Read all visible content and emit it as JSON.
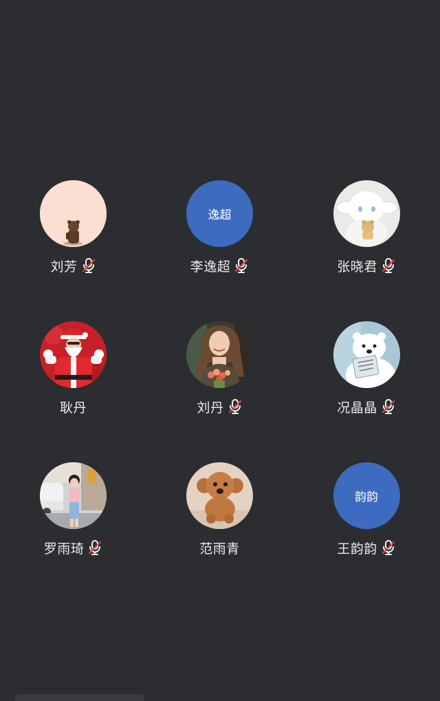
{
  "participants": [
    {
      "name": "刘芳",
      "avatar": "brown-bear-figure-on-peach",
      "muted": true
    },
    {
      "name": "李逸超",
      "avatar_text": "逸超",
      "muted": true
    },
    {
      "name": "张晓君",
      "avatar": "white-bunny-plush",
      "muted": true
    },
    {
      "name": "耿丹",
      "avatar": "santa-claus-on-red",
      "muted": false
    },
    {
      "name": "刘丹",
      "avatar": "woman-photo",
      "muted": true
    },
    {
      "name": "况晶晶",
      "avatar": "polar-bear-reading-book",
      "muted": true
    },
    {
      "name": "罗雨琦",
      "avatar": "girl-street-photo",
      "muted": true
    },
    {
      "name": "范雨青",
      "avatar": "brown-poodle-puppy",
      "muted": false
    },
    {
      "name": "王韵韵",
      "avatar_text": "韵韵",
      "muted": true
    }
  ],
  "colors": {
    "background": "#2b2d30",
    "text_avatar": "#3d6bc0",
    "muted_slash": "#e0453a"
  },
  "icons": {
    "muted": "mic-off-icon"
  }
}
